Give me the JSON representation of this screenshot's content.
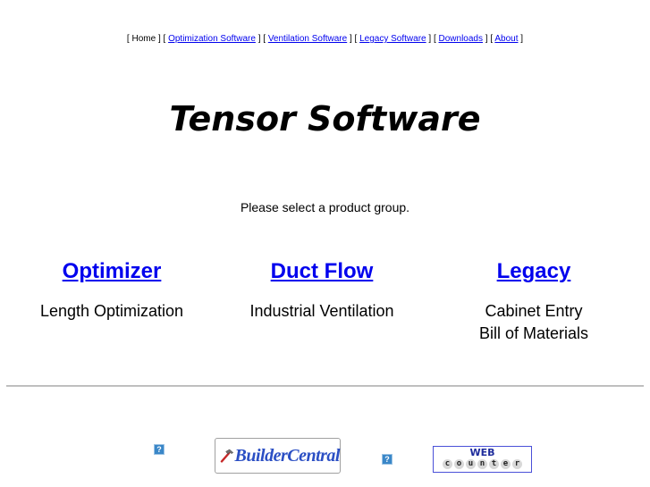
{
  "nav": {
    "items": [
      {
        "label": "Home",
        "link": false
      },
      {
        "label": "Optimization Software",
        "link": true
      },
      {
        "label": "Ventilation Software",
        "link": true
      },
      {
        "label": "Legacy Software",
        "link": true
      },
      {
        "label": "Downloads",
        "link": true
      },
      {
        "label": "About",
        "link": true
      }
    ],
    "open_bracket": "[",
    "close_bracket": "]"
  },
  "page": {
    "title": "Tensor Software",
    "prompt": "Please select a product group."
  },
  "groups": [
    {
      "name": "Optimizer",
      "lines": [
        "Length Optimization"
      ]
    },
    {
      "name": "Duct Flow",
      "lines": [
        "Industrial Ventilation"
      ]
    },
    {
      "name": "Legacy",
      "lines": [
        "Cabinet Entry",
        "Bill of Materials"
      ]
    }
  ],
  "footer": {
    "broken_image_glyph": "?",
    "builder_logo_text": "BuilderCentral",
    "counter_top": "WEB",
    "counter_letters": [
      "c",
      "o",
      "u",
      "n",
      "t",
      "e",
      "r"
    ]
  },
  "colors": {
    "link": "#0000ee",
    "rule": "#c8c8c8"
  }
}
